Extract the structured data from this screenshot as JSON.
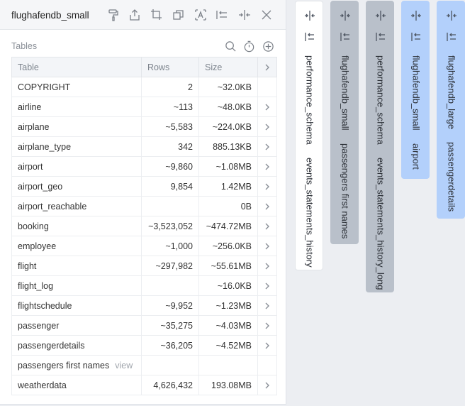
{
  "panel": {
    "title": "flughafendb_small",
    "icons": [
      "paint-roller-icon",
      "export-icon",
      "crop-icon",
      "copy-icon",
      "font-icon",
      "collapse-left-icon",
      "split-columns-icon",
      "close-icon"
    ]
  },
  "tables_section": {
    "label": "Tables",
    "icons": [
      "search-icon",
      "timer-icon",
      "add-icon"
    ]
  },
  "table": {
    "columns": [
      "Table",
      "Rows",
      "Size"
    ],
    "rows": [
      {
        "name": "COPYRIGHT",
        "rows": "2",
        "size": "~32.0KB",
        "has_arrow": false
      },
      {
        "name": "airline",
        "rows": "~113",
        "size": "~48.0KB",
        "has_arrow": true
      },
      {
        "name": "airplane",
        "rows": "~5,583",
        "size": "~224.0KB",
        "has_arrow": true
      },
      {
        "name": "airplane_type",
        "rows": "342",
        "size": "885.13KB",
        "has_arrow": true
      },
      {
        "name": "airport",
        "rows": "~9,860",
        "size": "~1.08MB",
        "has_arrow": true
      },
      {
        "name": "airport_geo",
        "rows": "9,854",
        "size": "1.42MB",
        "has_arrow": true
      },
      {
        "name": "airport_reachable",
        "rows": "",
        "size": "0B",
        "has_arrow": true
      },
      {
        "name": "booking",
        "rows": "~3,523,052",
        "size": "~474.72MB",
        "has_arrow": true
      },
      {
        "name": "employee",
        "rows": "~1,000",
        "size": "~256.0KB",
        "has_arrow": true
      },
      {
        "name": "flight",
        "rows": "~297,982",
        "size": "~55.61MB",
        "has_arrow": true
      },
      {
        "name": "flight_log",
        "rows": "",
        "size": "~16.0KB",
        "has_arrow": true
      },
      {
        "name": "flightschedule",
        "rows": "~9,952",
        "size": "~1.23MB",
        "has_arrow": true
      },
      {
        "name": "passenger",
        "rows": "~35,275",
        "size": "~4.03MB",
        "has_arrow": true
      },
      {
        "name": "passengerdetails",
        "rows": "~36,205",
        "size": "~4.52MB",
        "has_arrow": true
      },
      {
        "name": "passengers first names",
        "view_label": "view",
        "rows": "",
        "size": "",
        "has_arrow": false
      },
      {
        "name": "weatherdata",
        "rows": "4,626,432",
        "size": "193.08MB",
        "has_arrow": true
      }
    ]
  },
  "side_tabs": [
    {
      "db": "performance_schema",
      "table": "events_statements_history",
      "bg": "#ffffff",
      "border": "#e2e5e9"
    },
    {
      "db": "flughafendb_small",
      "table": "passengers first names",
      "bg": "#b9c0ca",
      "border": "#b9c0ca"
    },
    {
      "db": "performance_schema",
      "table": "events_statements_history_long",
      "bg": "#b9c0ca",
      "border": "#b9c0ca"
    },
    {
      "db": "flughafendb_small",
      "table": "airport",
      "bg": "#b3d0fb",
      "border": "#b3d0fb"
    },
    {
      "db": "flughafendb_large",
      "table": "passengerdetails",
      "bg": "#b3d0fb",
      "border": "#b3d0fb"
    }
  ]
}
